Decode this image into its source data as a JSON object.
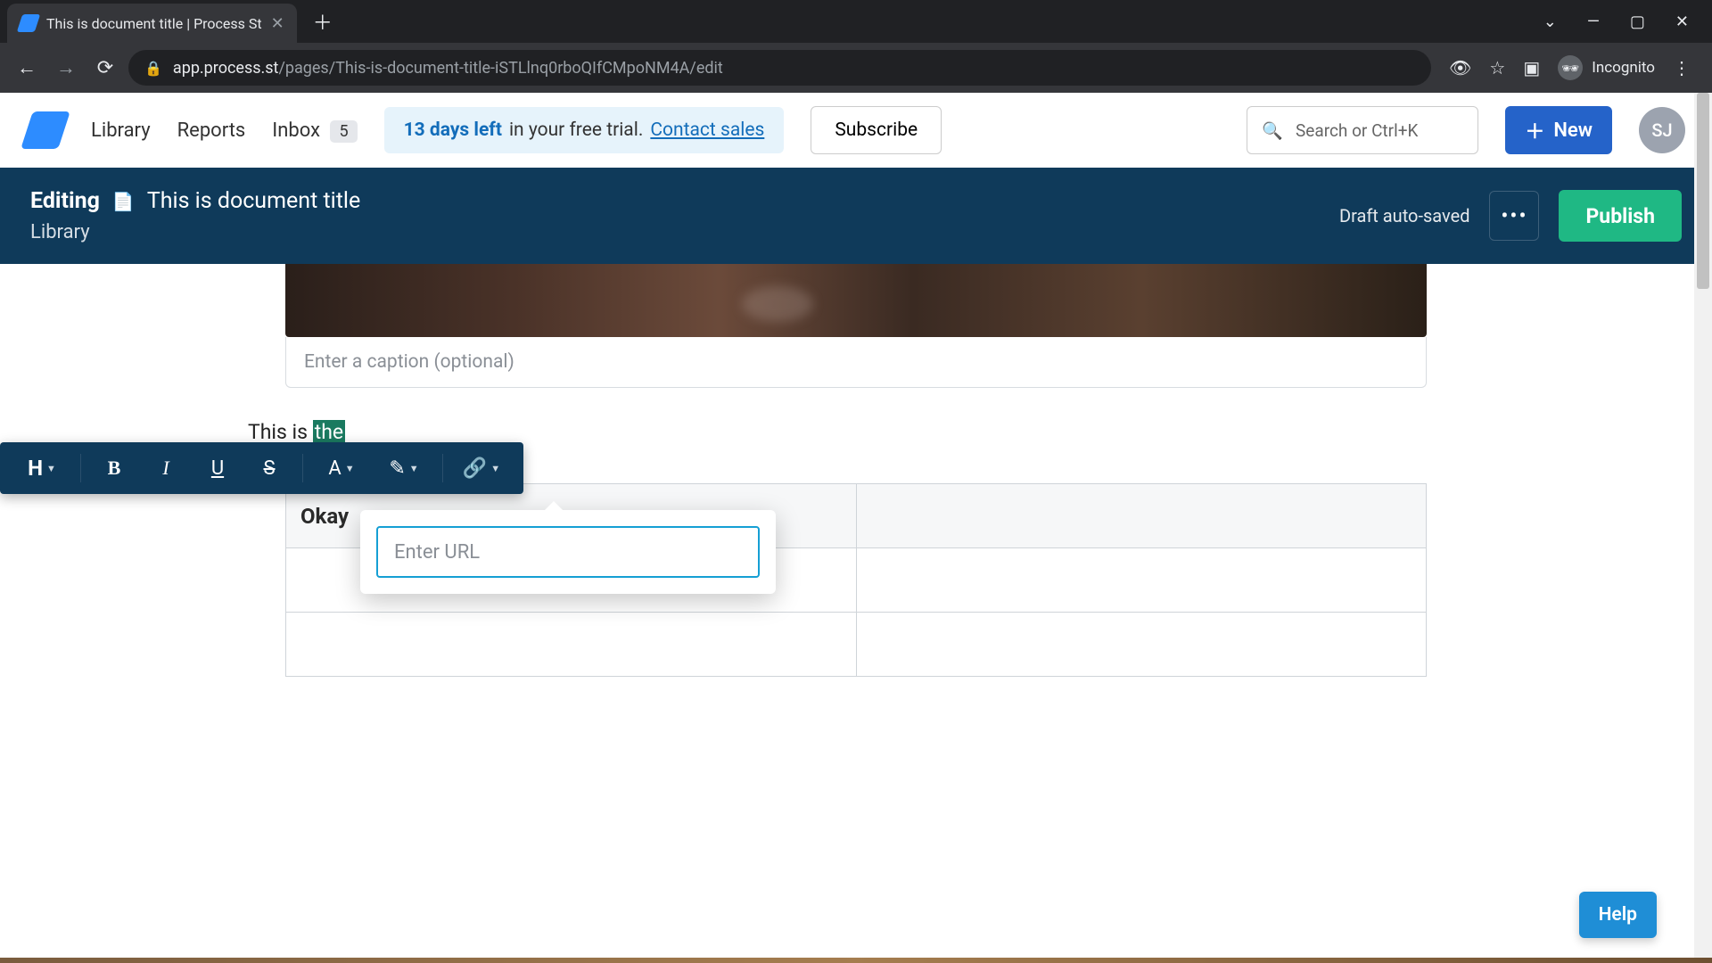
{
  "browser": {
    "tab_title": "This is document title | Process St",
    "url_domain": "app.process.st",
    "url_path": "/pages/This-is-document-title-iSTLlnq0rboQIfCMpoNM4A/edit",
    "incognito_label": "Incognito"
  },
  "header": {
    "nav": {
      "library": "Library",
      "reports": "Reports",
      "inbox": "Inbox",
      "inbox_count": "5"
    },
    "trial": {
      "days": "13 days left",
      "rest": " in your free trial.",
      "contact": "Contact sales"
    },
    "subscribe": "Subscribe",
    "search_placeholder": "Search or Ctrl+K",
    "new_btn": "New",
    "avatar": "SJ"
  },
  "edit_bar": {
    "label": "Editing",
    "title": "This is document title",
    "breadcrumb": "Library",
    "autosave": "Draft auto-saved",
    "publish": "Publish"
  },
  "image": {
    "caption_placeholder": "Enter a caption (optional)"
  },
  "toolbar": {
    "heading": "H",
    "bold": "B",
    "italic": "I",
    "underline": "U",
    "strike": "S",
    "textcolor": "A"
  },
  "text_block": {
    "before": "This is ",
    "selected": "the"
  },
  "url_popover": {
    "placeholder": "Enter URL"
  },
  "table": {
    "header_left": "Okay",
    "header_right": ""
  },
  "help": "Help"
}
